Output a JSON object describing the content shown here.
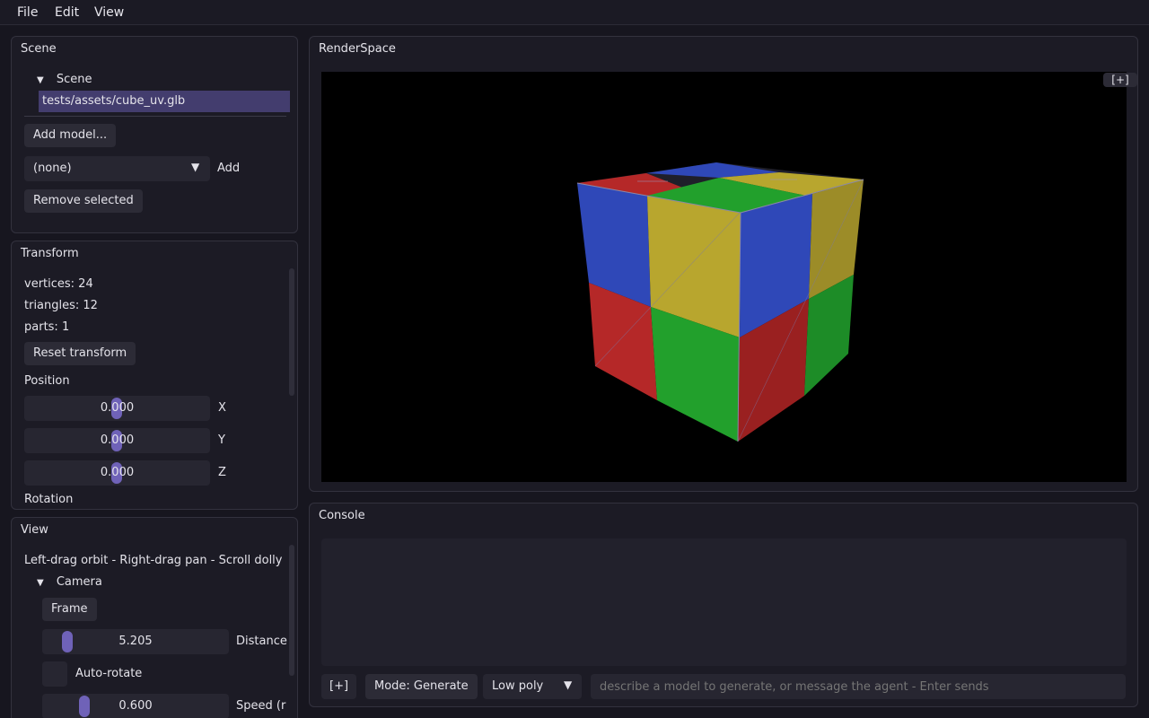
{
  "menu": {
    "file": "File",
    "edit": "Edit",
    "view": "View"
  },
  "scene_panel": {
    "title": "Scene",
    "tree_root": "Scene",
    "selected_item": "tests/assets/cube_uv.glb",
    "add_model_label": "Add model...",
    "dropdown_value": "(none)",
    "add_label": "Add",
    "remove_label": "Remove selected"
  },
  "transform_panel": {
    "title": "Transform",
    "vertices": "vertices: 24",
    "triangles": "triangles: 12",
    "parts": "parts: 1",
    "reset_label": "Reset transform",
    "position_label": "Position",
    "pos_x": "0.000",
    "pos_y": "0.000",
    "pos_z": "0.000",
    "axis_x": "X",
    "axis_y": "Y",
    "axis_z": "Z",
    "rotation_label": "Rotation"
  },
  "view_panel": {
    "title": "View",
    "hint": "Left-drag orbit - Right-drag pan - Scroll dolly",
    "camera_label": "Camera",
    "frame_label": "Frame",
    "distance_value": "5.205",
    "distance_label": "Distance",
    "autorotate_label": "Auto-rotate",
    "speed_value": "0.600",
    "speed_label": "Speed (ra"
  },
  "render": {
    "title": "RenderSpace",
    "expand_label": "[+]"
  },
  "console": {
    "title": "Console",
    "expand_label": "[+]",
    "mode_label": "Mode: Generate",
    "quality_value": "Low poly",
    "input_placeholder": "describe a model to generate, or message the agent - Enter sends"
  },
  "colors": {
    "accent": "#6f62b8",
    "cube_blue": "#2f48b8",
    "cube_yellow": "#b8a62e",
    "cube_red": "#b52828",
    "cube_green": "#22a02c"
  }
}
